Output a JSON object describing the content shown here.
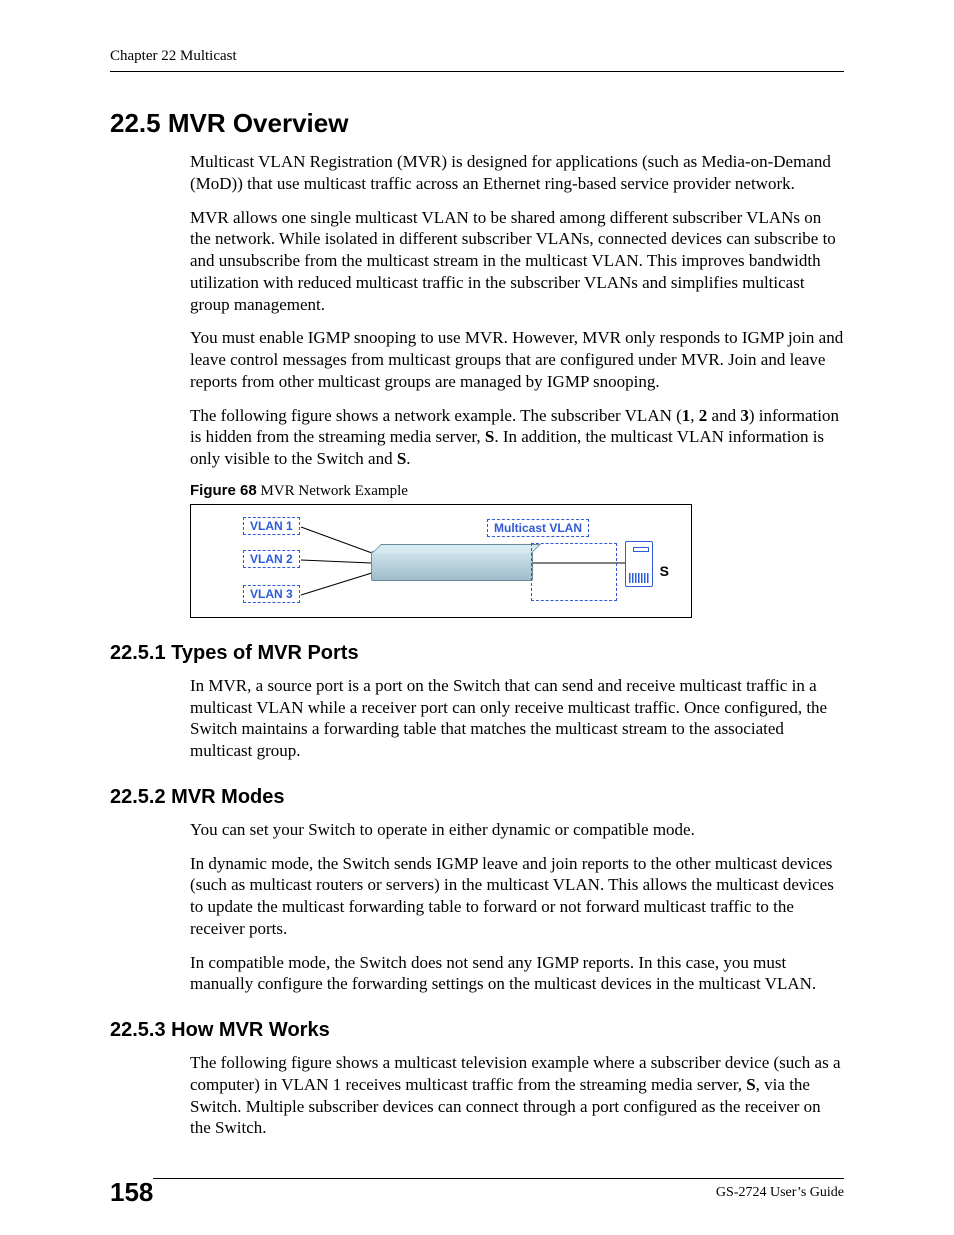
{
  "header": {
    "running": "Chapter 22 Multicast"
  },
  "sections": {
    "s22_5": {
      "title": "22.5  MVR Overview",
      "p1": "Multicast VLAN Registration (MVR) is designed for applications (such as Media-on-Demand (MoD)) that use multicast traffic across an Ethernet ring-based service provider network.",
      "p2": "MVR allows one single multicast VLAN to be shared among different subscriber VLANs on the network. While isolated in different subscriber VLANs, connected devices can subscribe to and unsubscribe from the multicast stream in the multicast VLAN. This improves bandwidth utilization with reduced multicast traffic in the subscriber VLANs and simplifies multicast group management.",
      "p3": "You must enable IGMP snooping to use MVR. However, MVR only responds to IGMP join and leave control messages from multicast groups that are configured under MVR. Join and leave reports from other multicast groups are managed by IGMP snooping.",
      "p4_pre": "The following figure shows a network example. The subscriber VLAN (",
      "p4_b1": "1",
      "p4_c1": ", ",
      "p4_b2": "2",
      "p4_c2": " and ",
      "p4_b3": "3",
      "p4_mid": ") information is hidden from the streaming media server, ",
      "p4_bS1": "S",
      "p4_mid2": ". In addition, the multicast VLAN information is only visible to the Switch and ",
      "p4_bS2": "S",
      "p4_end": "."
    },
    "figure": {
      "lead": "Figure 68",
      "caption": "   MVR Network Example",
      "vlan1": "VLAN 1",
      "vlan2": "VLAN 2",
      "vlan3": "VLAN 3",
      "mcast": "Multicast VLAN",
      "s": "S"
    },
    "s22_5_1": {
      "title": "22.5.1  Types of MVR Ports",
      "p1": "In MVR, a source port is a port on the Switch that can send and receive multicast traffic in a multicast VLAN while a receiver port can only receive multicast traffic. Once configured, the Switch maintains a forwarding table that matches the multicast stream to the associated multicast group."
    },
    "s22_5_2": {
      "title": "22.5.2  MVR Modes",
      "p1": "You can set your Switch to operate in either dynamic or compatible mode.",
      "p2": "In dynamic mode, the Switch sends IGMP leave and join reports to the other multicast devices (such as multicast routers or servers) in the multicast VLAN. This allows the multicast devices to update the multicast forwarding table to forward or not forward multicast traffic to the receiver ports.",
      "p3": "In compatible mode, the Switch does not send any IGMP reports. In this case, you must manually configure the forwarding settings on the multicast devices in the multicast VLAN."
    },
    "s22_5_3": {
      "title": "22.5.3  How MVR Works",
      "p1_pre": "The following figure shows a multicast television example where a subscriber device (such as a computer) in VLAN 1 receives multicast traffic from the streaming media server, ",
      "p1_bS": "S",
      "p1_post": ", via the Switch. Multiple subscriber devices can connect through a port configured as the receiver on the Switch."
    }
  },
  "footer": {
    "page": "158",
    "guide": "GS-2724 User’s Guide"
  }
}
